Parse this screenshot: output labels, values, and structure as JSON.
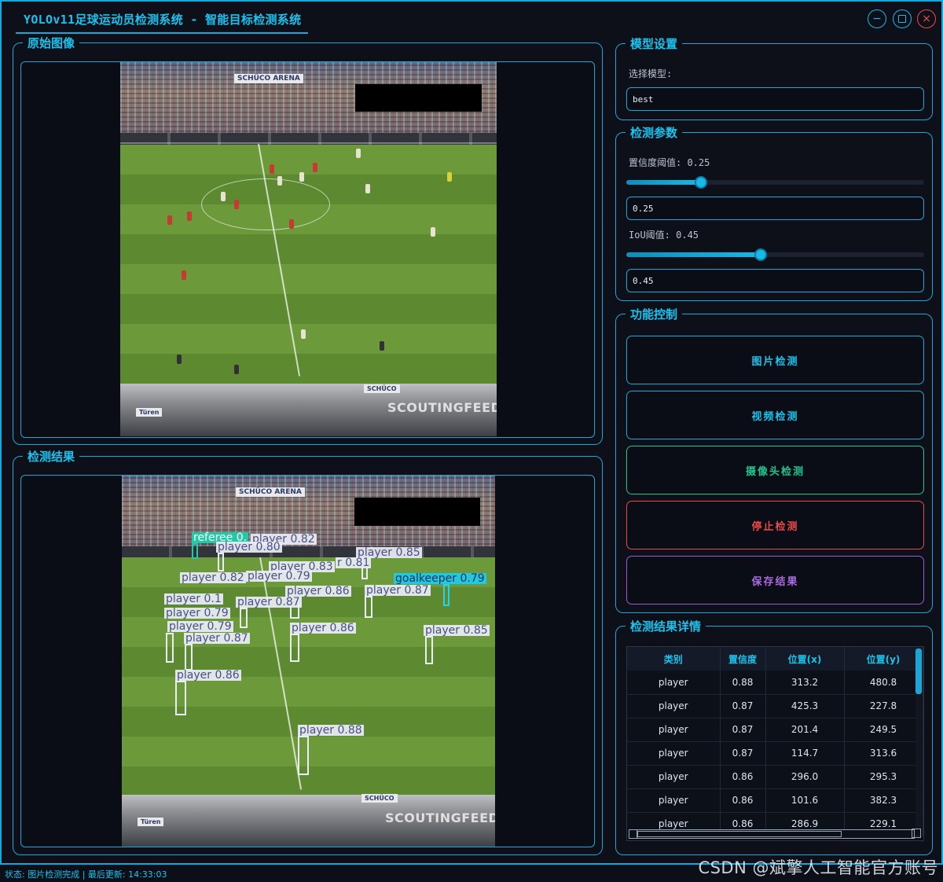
{
  "window": {
    "title": "YOLOv11足球运动员检测系统 - 智能目标检测系统"
  },
  "panels": {
    "original": {
      "title": "原始图像"
    },
    "result": {
      "title": "检测结果"
    }
  },
  "images": {
    "stadium_brand": "SCHÜCO ARENA",
    "watermark": "SCOUTINGFEED",
    "schuco_left": "SCHÜCO",
    "turen": "Türen"
  },
  "model": {
    "title": "模型设置",
    "select_label": "选择模型:",
    "selected": "best"
  },
  "params": {
    "title": "检测参数",
    "conf_label": "置信度阈值: 0.25",
    "conf_value": "0.25",
    "conf_level": 0.25,
    "iou_label": "IoU阈值: 0.45",
    "iou_value": "0.45",
    "iou_level": 0.45
  },
  "controls": {
    "title": "功能控制",
    "image_detect": "图片检测",
    "video_detect": "视频检测",
    "camera_detect": "摄像头检测",
    "stop_detect": "停止检测",
    "save_result": "保存结果"
  },
  "colors": {
    "accent": "#19c3ee",
    "image_btn": "#1aa6d6",
    "video_btn": "#1aa6d6",
    "camera_btn": "#20c48f",
    "stop_btn": "#e84a4a",
    "save_btn": "#9b59d6"
  },
  "details": {
    "title": "检测结果详情",
    "headers": [
      "类别",
      "置信度",
      "位置(x)",
      "位置(y)"
    ],
    "rows": [
      [
        "player",
        "0.88",
        "313.2",
        "480.8"
      ],
      [
        "player",
        "0.87",
        "425.3",
        "227.8"
      ],
      [
        "player",
        "0.87",
        "201.4",
        "249.5"
      ],
      [
        "player",
        "0.87",
        "114.7",
        "313.6"
      ],
      [
        "player",
        "0.86",
        "296.0",
        "295.3"
      ],
      [
        "player",
        "0.86",
        "101.6",
        "382.3"
      ],
      [
        "player",
        "0.86",
        "286.9",
        "229.1"
      ]
    ]
  },
  "detections": [
    {
      "label": "referee 0.",
      "type": "referee"
    },
    {
      "label": "player 0.82",
      "type": "player"
    },
    {
      "label": "player 0.80",
      "type": "player"
    },
    {
      "label": "player 0.85",
      "type": "player"
    },
    {
      "label": "player 0.83",
      "type": "player"
    },
    {
      "label": "r 0.81",
      "type": "player"
    },
    {
      "label": "player 0.82",
      "type": "player"
    },
    {
      "label": "player 0.79",
      "type": "player"
    },
    {
      "label": "goalkeeper 0.79",
      "type": "goalkeeper"
    },
    {
      "label": "player 0.86",
      "type": "player"
    },
    {
      "label": "player 0.87",
      "type": "player"
    },
    {
      "label": "player 0.1",
      "type": "player"
    },
    {
      "label": "player 0.87",
      "type": "player"
    },
    {
      "label": "player 0.79",
      "type": "player"
    },
    {
      "label": "player 0.79",
      "type": "player"
    },
    {
      "label": "player 0.86",
      "type": "player"
    },
    {
      "label": "player 0.87",
      "type": "player"
    },
    {
      "label": "player 0.85",
      "type": "player"
    },
    {
      "label": "player 0.86",
      "type": "player"
    },
    {
      "label": "player 0.88",
      "type": "player"
    }
  ],
  "status": {
    "text": "状态: 图片检测完成 | 最后更新: 14:33:03"
  },
  "footer": {
    "watermark": "CSDN @斌擎人工智能官方账号"
  }
}
